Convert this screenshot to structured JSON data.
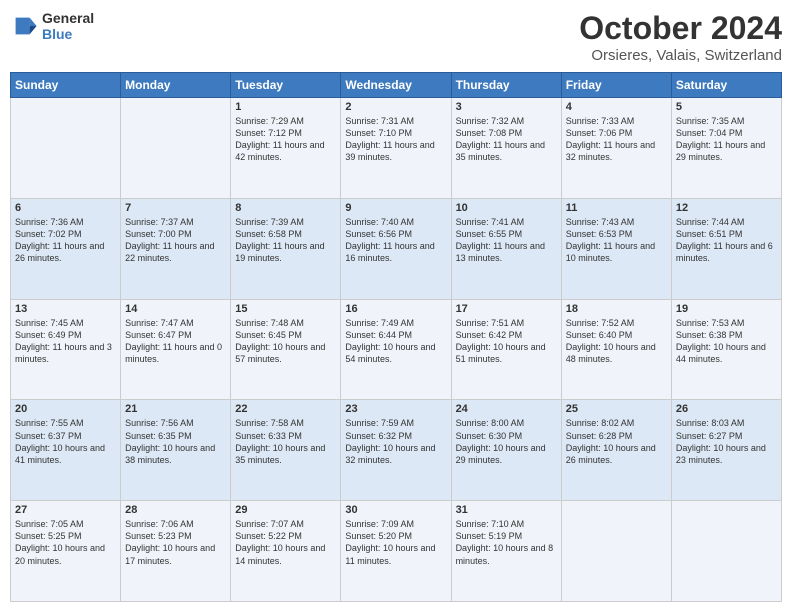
{
  "header": {
    "logo_line1": "General",
    "logo_line2": "Blue",
    "month": "October 2024",
    "location": "Orsieres, Valais, Switzerland"
  },
  "days_of_week": [
    "Sunday",
    "Monday",
    "Tuesday",
    "Wednesday",
    "Thursday",
    "Friday",
    "Saturday"
  ],
  "weeks": [
    [
      {
        "day": "",
        "text": ""
      },
      {
        "day": "",
        "text": ""
      },
      {
        "day": "1",
        "text": "Sunrise: 7:29 AM\nSunset: 7:12 PM\nDaylight: 11 hours and 42 minutes."
      },
      {
        "day": "2",
        "text": "Sunrise: 7:31 AM\nSunset: 7:10 PM\nDaylight: 11 hours and 39 minutes."
      },
      {
        "day": "3",
        "text": "Sunrise: 7:32 AM\nSunset: 7:08 PM\nDaylight: 11 hours and 35 minutes."
      },
      {
        "day": "4",
        "text": "Sunrise: 7:33 AM\nSunset: 7:06 PM\nDaylight: 11 hours and 32 minutes."
      },
      {
        "day": "5",
        "text": "Sunrise: 7:35 AM\nSunset: 7:04 PM\nDaylight: 11 hours and 29 minutes."
      }
    ],
    [
      {
        "day": "6",
        "text": "Sunrise: 7:36 AM\nSunset: 7:02 PM\nDaylight: 11 hours and 26 minutes."
      },
      {
        "day": "7",
        "text": "Sunrise: 7:37 AM\nSunset: 7:00 PM\nDaylight: 11 hours and 22 minutes."
      },
      {
        "day": "8",
        "text": "Sunrise: 7:39 AM\nSunset: 6:58 PM\nDaylight: 11 hours and 19 minutes."
      },
      {
        "day": "9",
        "text": "Sunrise: 7:40 AM\nSunset: 6:56 PM\nDaylight: 11 hours and 16 minutes."
      },
      {
        "day": "10",
        "text": "Sunrise: 7:41 AM\nSunset: 6:55 PM\nDaylight: 11 hours and 13 minutes."
      },
      {
        "day": "11",
        "text": "Sunrise: 7:43 AM\nSunset: 6:53 PM\nDaylight: 11 hours and 10 minutes."
      },
      {
        "day": "12",
        "text": "Sunrise: 7:44 AM\nSunset: 6:51 PM\nDaylight: 11 hours and 6 minutes."
      }
    ],
    [
      {
        "day": "13",
        "text": "Sunrise: 7:45 AM\nSunset: 6:49 PM\nDaylight: 11 hours and 3 minutes."
      },
      {
        "day": "14",
        "text": "Sunrise: 7:47 AM\nSunset: 6:47 PM\nDaylight: 11 hours and 0 minutes."
      },
      {
        "day": "15",
        "text": "Sunrise: 7:48 AM\nSunset: 6:45 PM\nDaylight: 10 hours and 57 minutes."
      },
      {
        "day": "16",
        "text": "Sunrise: 7:49 AM\nSunset: 6:44 PM\nDaylight: 10 hours and 54 minutes."
      },
      {
        "day": "17",
        "text": "Sunrise: 7:51 AM\nSunset: 6:42 PM\nDaylight: 10 hours and 51 minutes."
      },
      {
        "day": "18",
        "text": "Sunrise: 7:52 AM\nSunset: 6:40 PM\nDaylight: 10 hours and 48 minutes."
      },
      {
        "day": "19",
        "text": "Sunrise: 7:53 AM\nSunset: 6:38 PM\nDaylight: 10 hours and 44 minutes."
      }
    ],
    [
      {
        "day": "20",
        "text": "Sunrise: 7:55 AM\nSunset: 6:37 PM\nDaylight: 10 hours and 41 minutes."
      },
      {
        "day": "21",
        "text": "Sunrise: 7:56 AM\nSunset: 6:35 PM\nDaylight: 10 hours and 38 minutes."
      },
      {
        "day": "22",
        "text": "Sunrise: 7:58 AM\nSunset: 6:33 PM\nDaylight: 10 hours and 35 minutes."
      },
      {
        "day": "23",
        "text": "Sunrise: 7:59 AM\nSunset: 6:32 PM\nDaylight: 10 hours and 32 minutes."
      },
      {
        "day": "24",
        "text": "Sunrise: 8:00 AM\nSunset: 6:30 PM\nDaylight: 10 hours and 29 minutes."
      },
      {
        "day": "25",
        "text": "Sunrise: 8:02 AM\nSunset: 6:28 PM\nDaylight: 10 hours and 26 minutes."
      },
      {
        "day": "26",
        "text": "Sunrise: 8:03 AM\nSunset: 6:27 PM\nDaylight: 10 hours and 23 minutes."
      }
    ],
    [
      {
        "day": "27",
        "text": "Sunrise: 7:05 AM\nSunset: 5:25 PM\nDaylight: 10 hours and 20 minutes."
      },
      {
        "day": "28",
        "text": "Sunrise: 7:06 AM\nSunset: 5:23 PM\nDaylight: 10 hours and 17 minutes."
      },
      {
        "day": "29",
        "text": "Sunrise: 7:07 AM\nSunset: 5:22 PM\nDaylight: 10 hours and 14 minutes."
      },
      {
        "day": "30",
        "text": "Sunrise: 7:09 AM\nSunset: 5:20 PM\nDaylight: 10 hours and 11 minutes."
      },
      {
        "day": "31",
        "text": "Sunrise: 7:10 AM\nSunset: 5:19 PM\nDaylight: 10 hours and 8 minutes."
      },
      {
        "day": "",
        "text": ""
      },
      {
        "day": "",
        "text": ""
      }
    ]
  ]
}
